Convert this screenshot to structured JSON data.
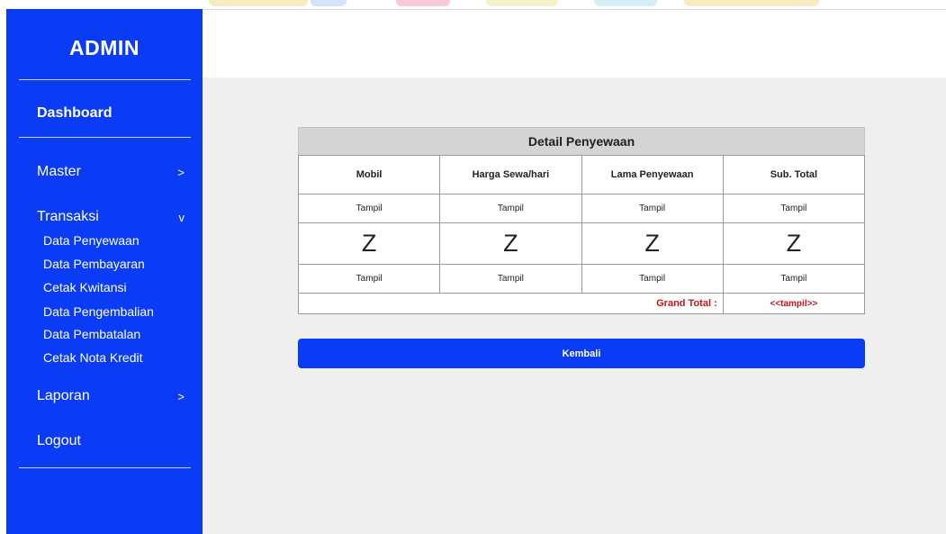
{
  "sidebar": {
    "brand": "ADMIN",
    "dashboard": "Dashboard",
    "master": {
      "label": "Master",
      "arrow": ">"
    },
    "transaksi": {
      "label": "Transaksi",
      "arrow": "v",
      "items": [
        "Data Penyewaan",
        "Data Pembayaran",
        "Cetak Kwitansi",
        "Data Pengembalian",
        "Data Pembatalan",
        "Cetak Nota Kredit"
      ]
    },
    "laporan": {
      "label": "Laporan",
      "arrow": ">"
    },
    "logout": "Logout"
  },
  "detail": {
    "title": "Detail Penyewaan",
    "columns": [
      "Mobil",
      "Harga Sewa/hari",
      "Lama Penyewaan",
      "Sub. Total"
    ],
    "rows": [
      [
        "Tampil",
        "Tampil",
        "Tampil",
        "Tampil"
      ],
      [
        "Z",
        "Z",
        "Z",
        "Z"
      ],
      [
        "Tampil",
        "Tampil",
        "Tampil",
        "Tampil"
      ]
    ],
    "grand_total_label": "Grand Total :",
    "grand_total_value": "<<tampil>>"
  },
  "actions": {
    "back_label": "Kembali"
  },
  "colors": {
    "sidebar": "#0a3cf5",
    "accent_red": "#c6131b",
    "background": "#efefef"
  }
}
